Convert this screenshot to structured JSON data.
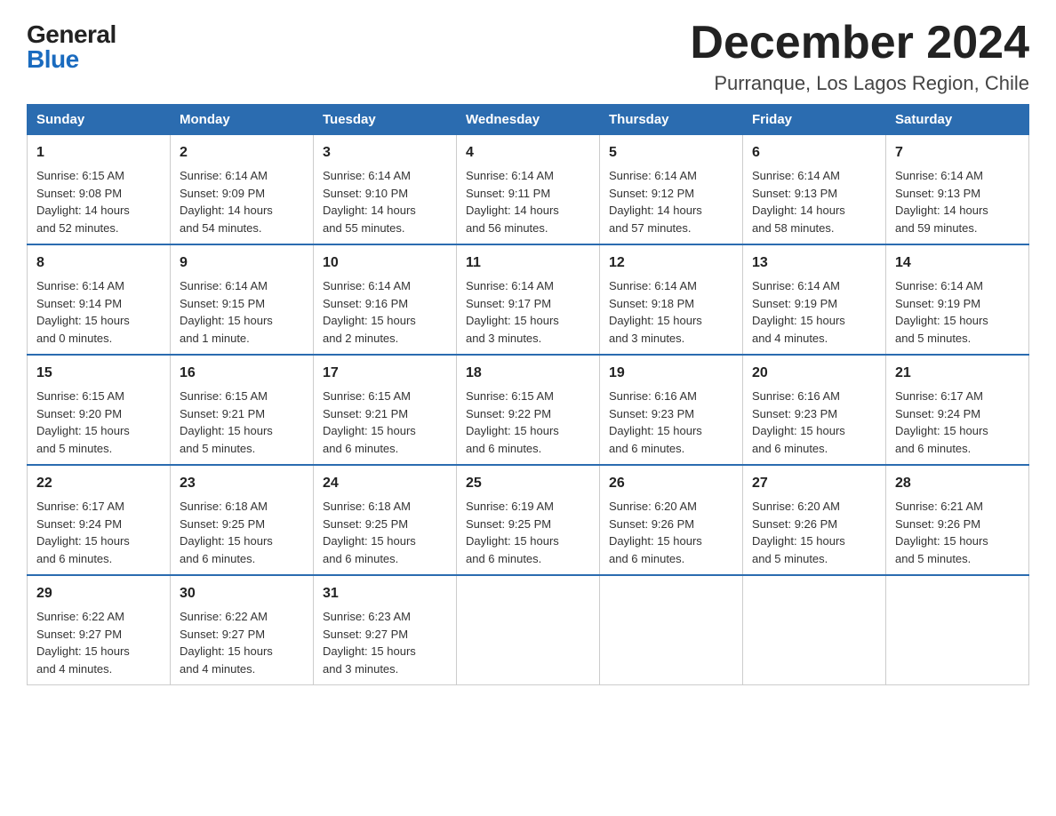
{
  "header": {
    "logo_general": "General",
    "logo_blue": "Blue",
    "month_title": "December 2024",
    "location": "Purranque, Los Lagos Region, Chile"
  },
  "days_of_week": [
    "Sunday",
    "Monday",
    "Tuesday",
    "Wednesday",
    "Thursday",
    "Friday",
    "Saturday"
  ],
  "weeks": [
    [
      {
        "day": "1",
        "info": "Sunrise: 6:15 AM\nSunset: 9:08 PM\nDaylight: 14 hours\nand 52 minutes."
      },
      {
        "day": "2",
        "info": "Sunrise: 6:14 AM\nSunset: 9:09 PM\nDaylight: 14 hours\nand 54 minutes."
      },
      {
        "day": "3",
        "info": "Sunrise: 6:14 AM\nSunset: 9:10 PM\nDaylight: 14 hours\nand 55 minutes."
      },
      {
        "day": "4",
        "info": "Sunrise: 6:14 AM\nSunset: 9:11 PM\nDaylight: 14 hours\nand 56 minutes."
      },
      {
        "day": "5",
        "info": "Sunrise: 6:14 AM\nSunset: 9:12 PM\nDaylight: 14 hours\nand 57 minutes."
      },
      {
        "day": "6",
        "info": "Sunrise: 6:14 AM\nSunset: 9:13 PM\nDaylight: 14 hours\nand 58 minutes."
      },
      {
        "day": "7",
        "info": "Sunrise: 6:14 AM\nSunset: 9:13 PM\nDaylight: 14 hours\nand 59 minutes."
      }
    ],
    [
      {
        "day": "8",
        "info": "Sunrise: 6:14 AM\nSunset: 9:14 PM\nDaylight: 15 hours\nand 0 minutes."
      },
      {
        "day": "9",
        "info": "Sunrise: 6:14 AM\nSunset: 9:15 PM\nDaylight: 15 hours\nand 1 minute."
      },
      {
        "day": "10",
        "info": "Sunrise: 6:14 AM\nSunset: 9:16 PM\nDaylight: 15 hours\nand 2 minutes."
      },
      {
        "day": "11",
        "info": "Sunrise: 6:14 AM\nSunset: 9:17 PM\nDaylight: 15 hours\nand 3 minutes."
      },
      {
        "day": "12",
        "info": "Sunrise: 6:14 AM\nSunset: 9:18 PM\nDaylight: 15 hours\nand 3 minutes."
      },
      {
        "day": "13",
        "info": "Sunrise: 6:14 AM\nSunset: 9:19 PM\nDaylight: 15 hours\nand 4 minutes."
      },
      {
        "day": "14",
        "info": "Sunrise: 6:14 AM\nSunset: 9:19 PM\nDaylight: 15 hours\nand 5 minutes."
      }
    ],
    [
      {
        "day": "15",
        "info": "Sunrise: 6:15 AM\nSunset: 9:20 PM\nDaylight: 15 hours\nand 5 minutes."
      },
      {
        "day": "16",
        "info": "Sunrise: 6:15 AM\nSunset: 9:21 PM\nDaylight: 15 hours\nand 5 minutes."
      },
      {
        "day": "17",
        "info": "Sunrise: 6:15 AM\nSunset: 9:21 PM\nDaylight: 15 hours\nand 6 minutes."
      },
      {
        "day": "18",
        "info": "Sunrise: 6:15 AM\nSunset: 9:22 PM\nDaylight: 15 hours\nand 6 minutes."
      },
      {
        "day": "19",
        "info": "Sunrise: 6:16 AM\nSunset: 9:23 PM\nDaylight: 15 hours\nand 6 minutes."
      },
      {
        "day": "20",
        "info": "Sunrise: 6:16 AM\nSunset: 9:23 PM\nDaylight: 15 hours\nand 6 minutes."
      },
      {
        "day": "21",
        "info": "Sunrise: 6:17 AM\nSunset: 9:24 PM\nDaylight: 15 hours\nand 6 minutes."
      }
    ],
    [
      {
        "day": "22",
        "info": "Sunrise: 6:17 AM\nSunset: 9:24 PM\nDaylight: 15 hours\nand 6 minutes."
      },
      {
        "day": "23",
        "info": "Sunrise: 6:18 AM\nSunset: 9:25 PM\nDaylight: 15 hours\nand 6 minutes."
      },
      {
        "day": "24",
        "info": "Sunrise: 6:18 AM\nSunset: 9:25 PM\nDaylight: 15 hours\nand 6 minutes."
      },
      {
        "day": "25",
        "info": "Sunrise: 6:19 AM\nSunset: 9:25 PM\nDaylight: 15 hours\nand 6 minutes."
      },
      {
        "day": "26",
        "info": "Sunrise: 6:20 AM\nSunset: 9:26 PM\nDaylight: 15 hours\nand 6 minutes."
      },
      {
        "day": "27",
        "info": "Sunrise: 6:20 AM\nSunset: 9:26 PM\nDaylight: 15 hours\nand 5 minutes."
      },
      {
        "day": "28",
        "info": "Sunrise: 6:21 AM\nSunset: 9:26 PM\nDaylight: 15 hours\nand 5 minutes."
      }
    ],
    [
      {
        "day": "29",
        "info": "Sunrise: 6:22 AM\nSunset: 9:27 PM\nDaylight: 15 hours\nand 4 minutes."
      },
      {
        "day": "30",
        "info": "Sunrise: 6:22 AM\nSunset: 9:27 PM\nDaylight: 15 hours\nand 4 minutes."
      },
      {
        "day": "31",
        "info": "Sunrise: 6:23 AM\nSunset: 9:27 PM\nDaylight: 15 hours\nand 3 minutes."
      },
      {
        "day": "",
        "info": ""
      },
      {
        "day": "",
        "info": ""
      },
      {
        "day": "",
        "info": ""
      },
      {
        "day": "",
        "info": ""
      }
    ]
  ]
}
